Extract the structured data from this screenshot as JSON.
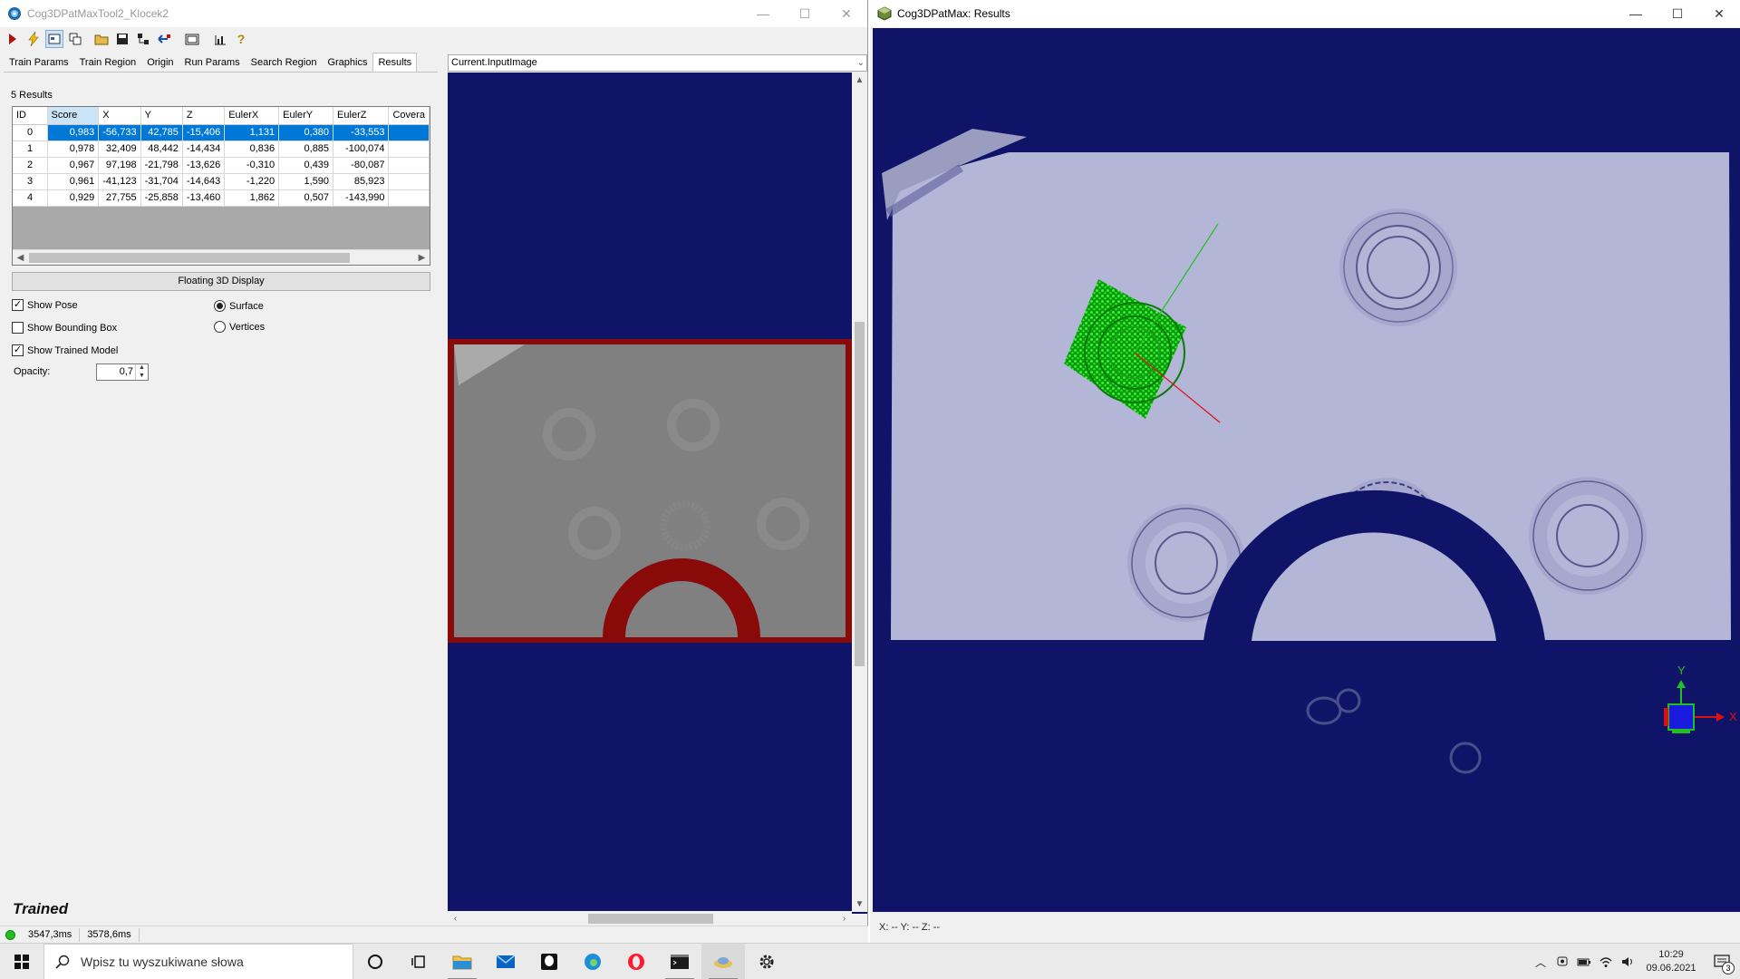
{
  "left_window": {
    "title": "Cog3DPatMaxTool2_Klocek2",
    "caption": {
      "minimize": "—",
      "maximize": "☐",
      "close": "✕"
    },
    "toolbar_icons": [
      "run-icon",
      "lightning-icon",
      "image-icon",
      "copy-icon",
      "open-folder-icon",
      "save-icon",
      "tree-icon",
      "reset-icon",
      "display-icon",
      "chart-icon",
      "help-icon"
    ],
    "tabs": [
      "Train Params",
      "Train Region",
      "Origin",
      "Run Params",
      "Search Region",
      "Graphics",
      "Results"
    ],
    "active_tab": "Results",
    "results_count": "5 Results",
    "columns": [
      "ID",
      "Score",
      "X",
      "Y",
      "Z",
      "EulerX",
      "EulerY",
      "EulerZ",
      "Covera"
    ],
    "rows": [
      [
        "0",
        "0,983",
        "-56,733",
        "42,785",
        "-15,406",
        "1,131",
        "0,380",
        "-33,553",
        ""
      ],
      [
        "1",
        "0,978",
        "32,409",
        "48,442",
        "-14,434",
        "0,836",
        "0,885",
        "-100,074",
        ""
      ],
      [
        "2",
        "0,967",
        "97,198",
        "-21,798",
        "-13,626",
        "-0,310",
        "0,439",
        "-80,087",
        ""
      ],
      [
        "3",
        "0,961",
        "-41,123",
        "-31,704",
        "-14,643",
        "-1,220",
        "1,590",
        "85,923",
        ""
      ],
      [
        "4",
        "0,929",
        "27,755",
        "-25,858",
        "-13,460",
        "1,862",
        "0,507",
        "-143,990",
        ""
      ]
    ],
    "selected_row": 0,
    "floating_button": "Floating 3D Display",
    "options": {
      "show_pose": "Show Pose",
      "show_bounding_box": "Show Bounding Box",
      "show_trained_model": "Show Trained Model",
      "surface": "Surface",
      "vertices": "Vertices",
      "opacity_label": "Opacity:",
      "opacity_value": "0,7"
    },
    "option_states": {
      "show_pose": true,
      "show_bounding_box": false,
      "show_trained_model": true,
      "render_mode": "Surface"
    },
    "trained_label": "Trained",
    "status": {
      "time1": "3547,3ms",
      "time2": "3578,6ms",
      "led_color": "#20c020"
    },
    "image_selector": "Current.InputImage"
  },
  "right_window": {
    "title": "Cog3DPatMax: Results",
    "caption": {
      "minimize": "—",
      "maximize": "☐",
      "close": "✕"
    },
    "coords_text": "X: --  Y: --  Z: --",
    "axis_labels": {
      "y": "Y",
      "x": "X"
    }
  },
  "taskbar": {
    "search_placeholder": "Wpisz tu wyszukiwane słowa",
    "apps": [
      "cortana-icon",
      "task-view-icon",
      "file-explorer-icon",
      "mail-icon",
      "alienware-icon",
      "edge-icon",
      "opera-icon",
      "terminal-icon",
      "cognex-icon",
      "settings-icon"
    ],
    "time": "10:29",
    "date": "09.06.2021",
    "notifications": "3"
  },
  "colors": {
    "background_blue": "#0f1469",
    "surface_gray": "#b4b6d8",
    "match_green": "#22dd22",
    "red_region": "#8a0a0a",
    "selection_blue": "#0078d7"
  }
}
